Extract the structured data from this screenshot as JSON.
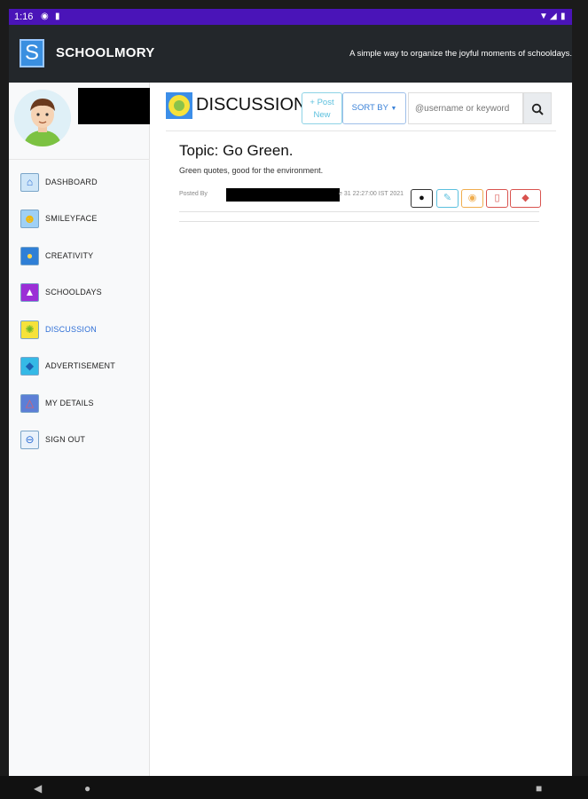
{
  "status_bar": {
    "time": "1:16"
  },
  "app": {
    "logo_letter": "S",
    "name": "SCHOOLMORY",
    "tagline": "A simple way to organize the joyful moments of schooldays."
  },
  "sidebar": {
    "items": [
      {
        "label": "DASHBOARD",
        "icon": "house-icon"
      },
      {
        "label": "SMILEYFACE",
        "icon": "smiley-icon"
      },
      {
        "label": "CREATIVITY",
        "icon": "lightbulb-icon"
      },
      {
        "label": "SCHOOLDAYS",
        "icon": "graduation-cap-icon"
      },
      {
        "label": "DISCUSSION",
        "icon": "sunflower-icon",
        "active": true
      },
      {
        "label": "ADVERTISEMENT",
        "icon": "ad-icon"
      },
      {
        "label": "MY DETAILS",
        "icon": "profile-icon"
      },
      {
        "label": "SIGN OUT",
        "icon": "sign-out-icon"
      }
    ]
  },
  "main": {
    "page_title": "DISCUSSION",
    "post_new_label": "+ Post\nNew",
    "sort_label": "SORT BY",
    "search_placeholder": "@username or keyword",
    "post": {
      "topic": "Topic: Go Green.",
      "description": "Green quotes, good for the environment.",
      "posted_by": "Posted By",
      "date_fragment": "e 31 22:27:00 IST 2021"
    }
  },
  "colors": {
    "status_bar": "#4a14b8",
    "app_bar": "#23272b",
    "accent": "#2f6fd6",
    "info": "#5bc0de",
    "warning": "#f0ad4e",
    "danger": "#d9534f"
  }
}
